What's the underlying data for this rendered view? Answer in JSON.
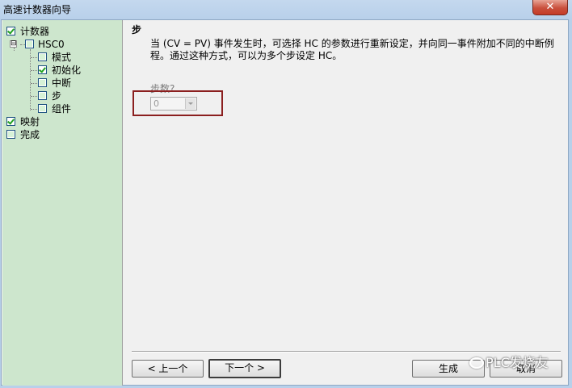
{
  "window": {
    "title": "高速计数器向导",
    "close_glyph": "✕"
  },
  "tree": {
    "items": [
      {
        "label": "计数器",
        "checked": true
      },
      {
        "label": "HSC0",
        "checked": false,
        "expander": "⊟"
      },
      {
        "label": "模式",
        "checked": false
      },
      {
        "label": "初始化",
        "checked": true
      },
      {
        "label": "中断",
        "checked": false
      },
      {
        "label": "步",
        "checked": false
      },
      {
        "label": "组件",
        "checked": false
      },
      {
        "label": "映射",
        "checked": true
      },
      {
        "label": "完成",
        "checked": false
      }
    ]
  },
  "page": {
    "title": "步",
    "description": "当 (CV = PV) 事件发生时，可选择 HC 的参数进行重新设定，并向同一事件附加不同的中断例程。通过这种方式，可以为多个步设定 HC。",
    "steps_label": "步数?",
    "steps_value": "0"
  },
  "buttons": {
    "prev": "< 上一个",
    "next": "下一个 >",
    "generate": "生成",
    "cancel": "取消"
  },
  "watermark": {
    "text": "PLC发烧友",
    "icon": "wechat-icon"
  },
  "colors": {
    "tree_bg": "#cde6cd",
    "highlight_border": "#8b1f1f",
    "check": "#21a121"
  }
}
